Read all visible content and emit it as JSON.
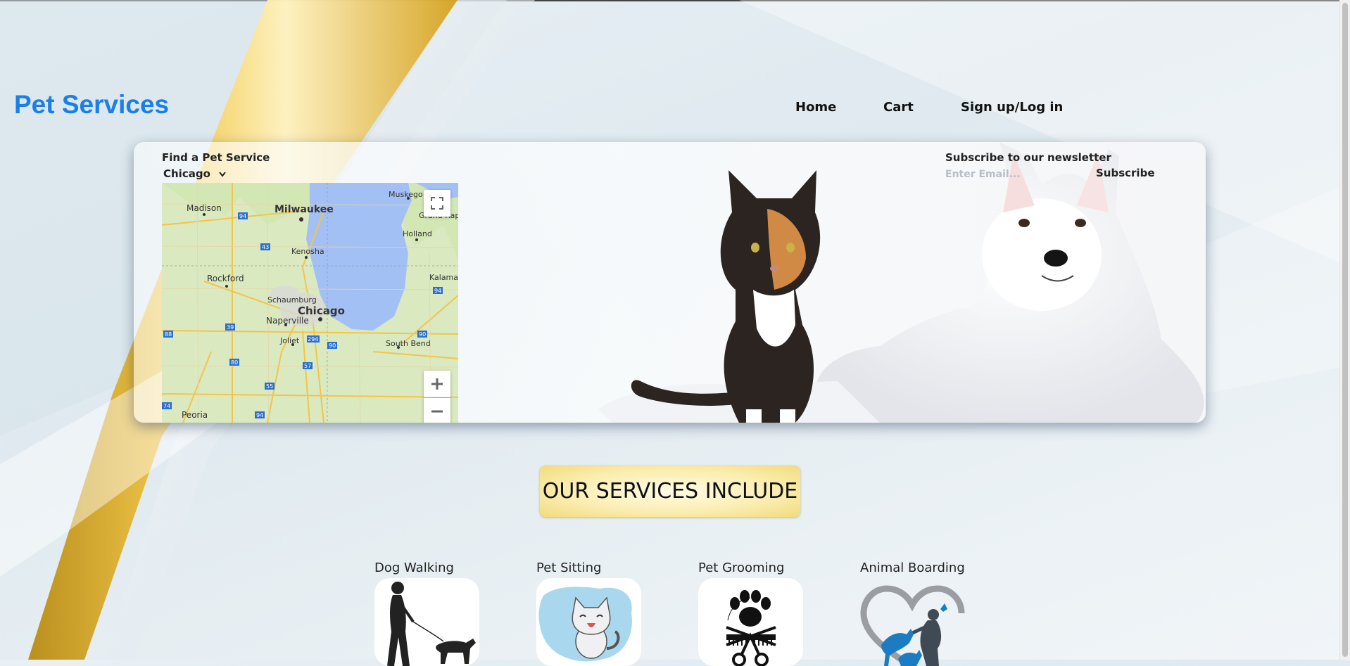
{
  "brand": {
    "name": "Pet Services"
  },
  "nav": {
    "home": "Home",
    "cart": "Cart",
    "signup": "Sign up/Log in"
  },
  "finder": {
    "label": "Find a Pet Service",
    "selected_city": "Chicago"
  },
  "map": {
    "cities": [
      "Muskego",
      "Madison",
      "Milwaukee",
      "Grand Rap",
      "Holland",
      "Kenosha",
      "Rockford",
      "Kalama",
      "Schaumburg",
      "Chicago",
      "Naperville",
      "Joliet",
      "South Bend",
      "Peoria"
    ],
    "highways": [
      "94",
      "43",
      "39",
      "88",
      "80",
      "294",
      "90",
      "57",
      "55",
      "74",
      "94",
      "90",
      "94"
    ]
  },
  "newsletter": {
    "label": "Subscribe to our newsletter",
    "placeholder": "Enter Email...",
    "button": "Subscribe"
  },
  "services": {
    "title": "OUR SERVICES INCLUDE",
    "items": [
      {
        "label": "Dog Walking"
      },
      {
        "label": "Pet Sitting"
      },
      {
        "label": "Pet Grooming"
      },
      {
        "label": "Animal Boarding"
      }
    ]
  },
  "colors": {
    "brand": "#1a7fe8",
    "lake": "#a3c0f4",
    "title_gold": "#f1db7d"
  }
}
